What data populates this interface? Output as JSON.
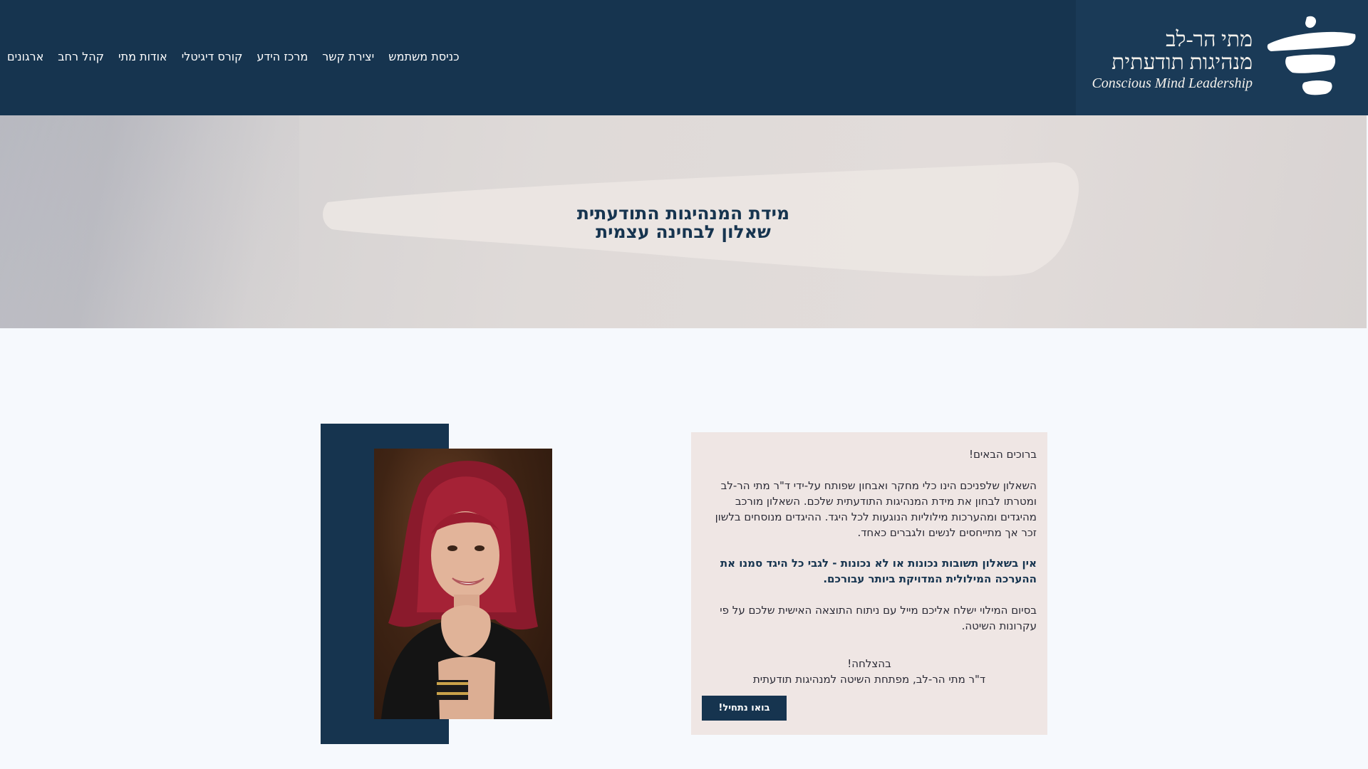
{
  "header": {
    "logo": {
      "line1": "מתי הר-לב",
      "line2": "מנהיגות תודעתית",
      "line3": "Conscious Mind Leadership"
    },
    "nav": [
      {
        "label": "ארגונים",
        "icon": ""
      },
      {
        "label": "קהל רחב"
      },
      {
        "label": "אודות מתי"
      },
      {
        "label": "קורס דיגיטלי"
      },
      {
        "label": "מרכז הידע"
      },
      {
        "label": "יצירת קשר"
      },
      {
        "label": "כניסת משתמש"
      }
    ],
    "language_icon": "globe-icon"
  },
  "hero": {
    "title_line1": "מידת המנהיגות התודעתית",
    "title_line2": "שאלון לבחינה עצמית"
  },
  "intro_card": {
    "welcome": "ברוכים הבאים!",
    "paragraph1": "השאלון שלפניכם הינו כלי מחקר ואבחון שפותח על-ידי ד\"ר מתי הר-לב ומטרתו לבחון את מידת המנהיגות התודעתית שלכם. השאלון מורכב מהיגדים ומהערכות מילוליות הנוגעות לכל היגד. ההיגדים מנוסחים בלשון זכר אך מתייחסים לנשים ולגברים כאחד.",
    "paragraph2_bold": "אין בשאלון תשובות נכונות או לא נכונות - לגבי כל היגד סמנו את ההערכה המילולית המדויקת ביותר עבורכם.",
    "paragraph3": "בסיום המילוי ישלח אליכם מייל עם ניתוח התוצאה האישית שלכם על פי עקרונות השיטה.",
    "sign_line1": "בהצלחה!",
    "sign_line2": "ד\"ר מתי הר-לב, מפתחת השיטה למנהיגות תודעתית",
    "cta_label": "בואו נתחיל!"
  },
  "colors": {
    "navy": "#16344f",
    "card_bg": "#efe6e4",
    "page_bg": "#f6f9fd"
  }
}
